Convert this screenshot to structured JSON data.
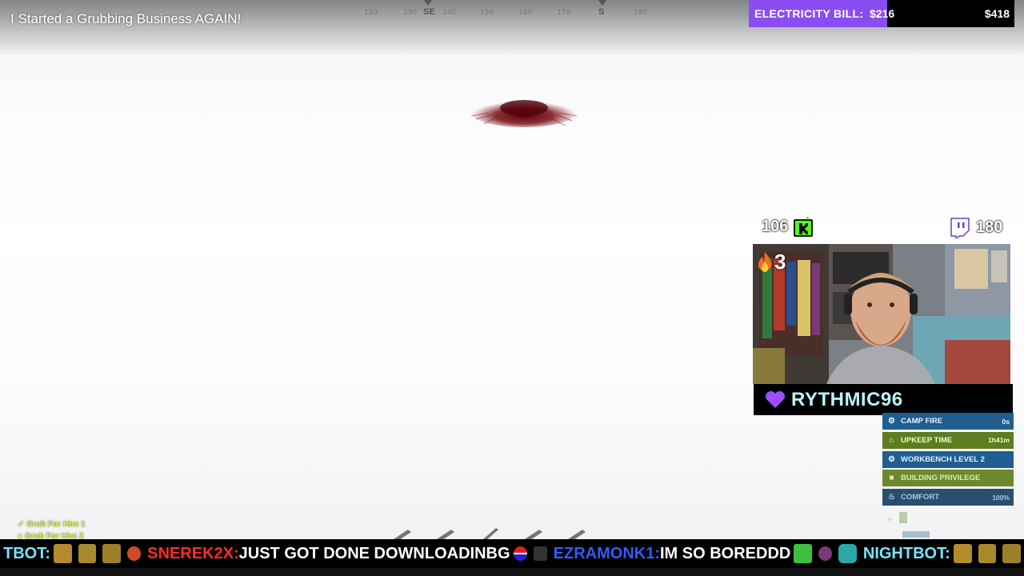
{
  "video": {
    "title": "I Started a Grubbing Business AGAIN!"
  },
  "compass": {
    "ticks": [
      "120",
      "130",
      "140",
      "150",
      "160",
      "170",
      "190"
    ],
    "directions": [
      "SE",
      "S"
    ]
  },
  "electricity_bill": {
    "label": "ELECTRICITY BILL:",
    "current": "$216",
    "total": "$418",
    "progress_fraction": 0.52,
    "fill_color": "#8a4df2"
  },
  "counters": {
    "kick_count": "106",
    "twitch_count": "180",
    "streak": "3"
  },
  "streamer": {
    "name": "RYTHMIC96"
  },
  "status": [
    {
      "label": "CAMP FIRE",
      "value": "0s",
      "icon": "gear-icon",
      "style": "blue"
    },
    {
      "label": "UPKEEP TIME",
      "value": "1h41m",
      "icon": "house-icon",
      "style": "green"
    },
    {
      "label": "WORKBENCH LEVEL 2",
      "value": "",
      "icon": "gear-icon",
      "style": "blue"
    },
    {
      "label": "BUILDING PRIVILEGE",
      "value": "",
      "icon": "cube-icon",
      "style": "dim-green"
    },
    {
      "label": "COMFORT",
      "value": "100%",
      "icon": "flame-icon",
      "style": "teal"
    }
  ],
  "team": [
    "Grub For Hire 1",
    "Grub For Hire 2"
  ],
  "ticker": {
    "items": [
      {
        "user": "TBOT:",
        "color": "cyan",
        "message": ""
      },
      {
        "user": "SNEREK2X:",
        "color": "red",
        "message": "JUST GOT DONE DOWNLOADINBG"
      },
      {
        "user": "EZRAMONK1:",
        "color": "blue",
        "message": "IM SO BOREDDD"
      },
      {
        "user": "NIGHTBOT:",
        "color": "cyan",
        "message": ""
      }
    ]
  }
}
